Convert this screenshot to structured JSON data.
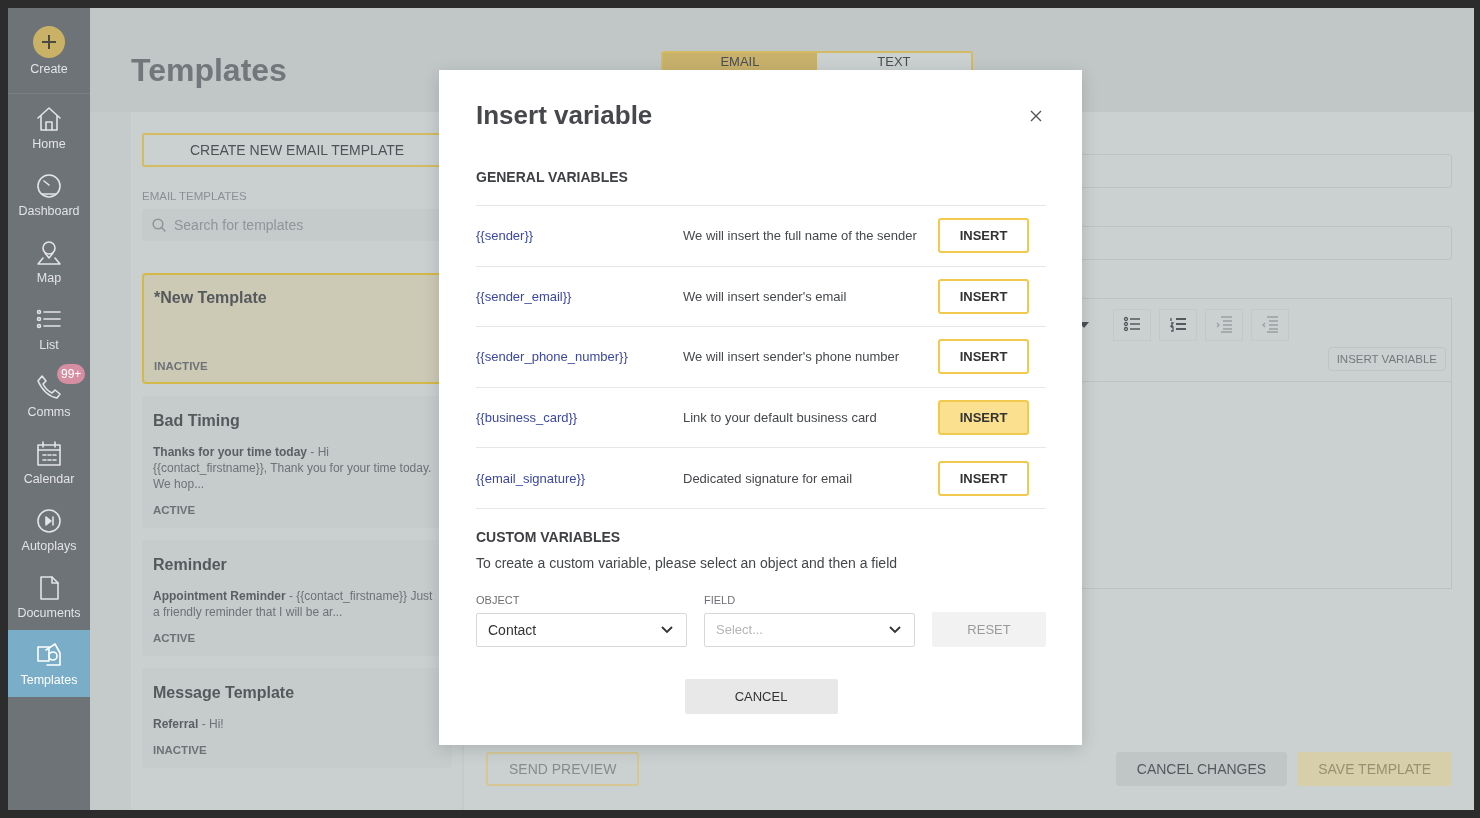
{
  "sidebar": {
    "items": [
      {
        "label": "Create",
        "kind": "create",
        "selected": false
      },
      {
        "label": "Home",
        "kind": "nav",
        "selected": false
      },
      {
        "label": "Dashboard",
        "kind": "nav",
        "selected": false
      },
      {
        "label": "Map",
        "kind": "nav",
        "selected": false
      },
      {
        "label": "List",
        "kind": "nav",
        "selected": false
      },
      {
        "label": "Comms",
        "kind": "nav",
        "selected": false,
        "badge": "99+"
      },
      {
        "label": "Calendar",
        "kind": "nav",
        "selected": false
      },
      {
        "label": "Autoplays",
        "kind": "nav",
        "selected": false
      },
      {
        "label": "Documents",
        "kind": "nav",
        "selected": false
      },
      {
        "label": "Templates",
        "kind": "nav",
        "selected": true
      }
    ]
  },
  "page": {
    "title": "Templates",
    "tabs": [
      {
        "label": "EMAIL",
        "selected": true
      },
      {
        "label": "TEXT",
        "selected": false
      }
    ]
  },
  "template_list": {
    "create_button": "CREATE NEW EMAIL TEMPLATE",
    "section_label": "EMAIL TEMPLATES",
    "search": {
      "placeholder": "Search for templates"
    },
    "templates": [
      {
        "name": "*New Template",
        "status": "INACTIVE",
        "selected": true
      },
      {
        "name": "Bad Timing",
        "preview": "**Thanks for your time today** - Hi {{contact_firstname}}, Thank you for your time today. We hop...",
        "status": "ACTIVE",
        "selected": false
      },
      {
        "name": "Reminder",
        "preview": "**Appointment Reminder** - {{contact_firstname}} Just a friendly reminder that I will be ar...",
        "status": "ACTIVE",
        "selected": false
      },
      {
        "name": "Message Template",
        "preview": "**Referral** - Hi!",
        "status": "INACTIVE",
        "selected": false
      }
    ]
  },
  "editor": {
    "insert_variable_button": "INSERT VARIABLE"
  },
  "footer": {
    "buttons": [
      {
        "label": "SEND PREVIEW",
        "kind": "outline",
        "disabled": true
      },
      {
        "label": "CANCEL CHANGES",
        "kind": "secondary",
        "disabled": false
      },
      {
        "label": "SAVE TEMPLATE",
        "kind": "primary",
        "disabled": true
      }
    ]
  },
  "modal": {
    "title": "Insert variable",
    "general_heading": "GENERAL VARIABLES",
    "variables": [
      {
        "name": "{{sender}}",
        "description": "We will insert the full name of the sender",
        "button": "INSERT",
        "highlighted": false
      },
      {
        "name": "{{sender_email}}",
        "description": "We will insert sender's email",
        "button": "INSERT",
        "highlighted": false
      },
      {
        "name": "{{sender_phone_number}}",
        "description": "We will insert sender's phone number",
        "button": "INSERT",
        "highlighted": false
      },
      {
        "name": "{{business_card}}",
        "description": "Link to your default business card",
        "button": "INSERT",
        "highlighted": true
      },
      {
        "name": "{{email_signature}}",
        "description": "Dedicated signature for email",
        "button": "INSERT",
        "highlighted": false
      }
    ],
    "custom_heading": "CUSTOM VARIABLES",
    "custom_hint": "To create a custom variable, please select an object and then a field",
    "object": {
      "label": "OBJECT",
      "value": "Contact"
    },
    "field": {
      "label": "FIELD",
      "placeholder": "Select..."
    },
    "reset_button": {
      "label": "RESET",
      "disabled": true
    },
    "cancel_button": "CANCEL"
  }
}
